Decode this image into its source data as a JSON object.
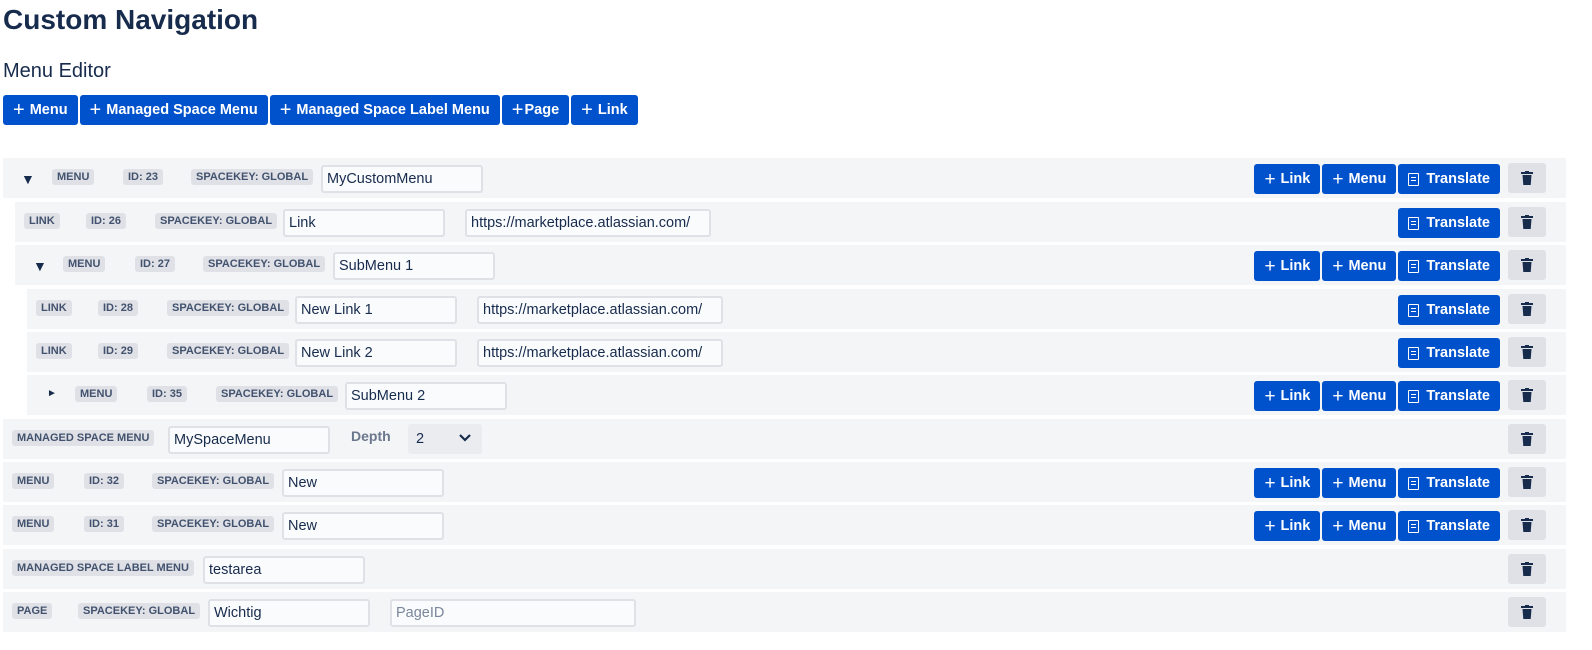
{
  "header": {
    "title": "Custom Navigation",
    "subtitle": "Menu Editor"
  },
  "toolbar": {
    "add_menu": "Menu",
    "add_managed_space_menu": "Managed Space Menu",
    "add_managed_space_label_menu": "Managed Space Label Menu",
    "add_page": "Page",
    "add_link": "Link"
  },
  "actions": {
    "link": "Link",
    "menu": "Menu",
    "translate": "Translate"
  },
  "depth_label": "Depth",
  "items": [
    {
      "type": "MENU",
      "id": "ID: 23",
      "spacekey": "SPACEKEY: GLOBAL",
      "name": "MyCustomMenu",
      "expanded": true
    },
    {
      "type": "LINK",
      "id": "ID: 26",
      "spacekey": "SPACEKEY: GLOBAL",
      "name": "Link",
      "url": "https://marketplace.atlassian.com/"
    },
    {
      "type": "MENU",
      "id": "ID: 27",
      "spacekey": "SPACEKEY: GLOBAL",
      "name": "SubMenu 1",
      "expanded": true
    },
    {
      "type": "LINK",
      "id": "ID: 28",
      "spacekey": "SPACEKEY: GLOBAL",
      "name": "New Link 1",
      "url": "https://marketplace.atlassian.com/"
    },
    {
      "type": "LINK",
      "id": "ID: 29",
      "spacekey": "SPACEKEY: GLOBAL",
      "name": "New Link 2",
      "url": "https://marketplace.atlassian.com/"
    },
    {
      "type": "MENU",
      "id": "ID: 35",
      "spacekey": "SPACEKEY: GLOBAL",
      "name": "SubMenu 2",
      "expanded": false
    },
    {
      "type": "MANAGED SPACE MENU",
      "name": "MySpaceMenu",
      "depth": "2"
    },
    {
      "type": "MENU",
      "id": "ID: 32",
      "spacekey": "SPACEKEY: GLOBAL",
      "name": "New"
    },
    {
      "type": "MENU",
      "id": "ID: 31",
      "spacekey": "SPACEKEY: GLOBAL",
      "name": "New"
    },
    {
      "type": "MANAGED SPACE LABEL MENU",
      "name": "testarea"
    },
    {
      "type": "PAGE",
      "spacekey": "SPACEKEY: GLOBAL",
      "name": "Wichtig",
      "page_id_placeholder": "PageID"
    }
  ],
  "icons": {
    "expanded": "caret-down-icon",
    "collapsed": "caret-right-icon",
    "add": "plus-icon",
    "translate": "document-icon",
    "delete": "trash-icon",
    "dropdown": "chevron-down-icon"
  },
  "colors": {
    "primary": "#0052cc",
    "row_bg": "#f4f5f7",
    "lozenge_bg": "#dfe1e6",
    "text": "#172b4d"
  }
}
